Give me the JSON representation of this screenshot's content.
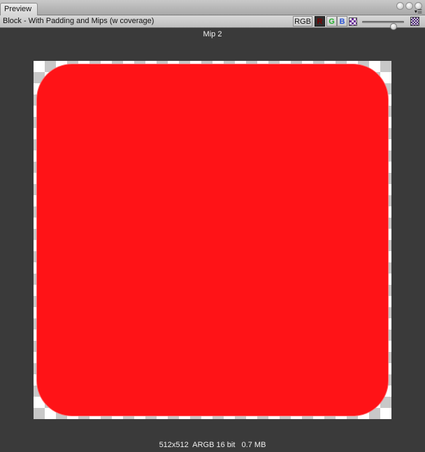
{
  "window": {
    "tab_label": "Preview"
  },
  "toolbar": {
    "asset_title": "Block - With Padding and Mips (w coverage)",
    "channels": {
      "rgb": "RGB",
      "r": "R",
      "g": "G",
      "b": "B"
    },
    "icons": {
      "alpha": "alpha-checker-icon",
      "mipmap": "mipmap-checker-icon"
    },
    "zoom_level": 0.8
  },
  "preview": {
    "mip_label": "Mip 2",
    "texture_color": "#ff1317",
    "checker_colors": [
      "#ffffff",
      "#c8c8c8"
    ],
    "info": "512x512  ARGB 16 bit   0.7 MB"
  }
}
